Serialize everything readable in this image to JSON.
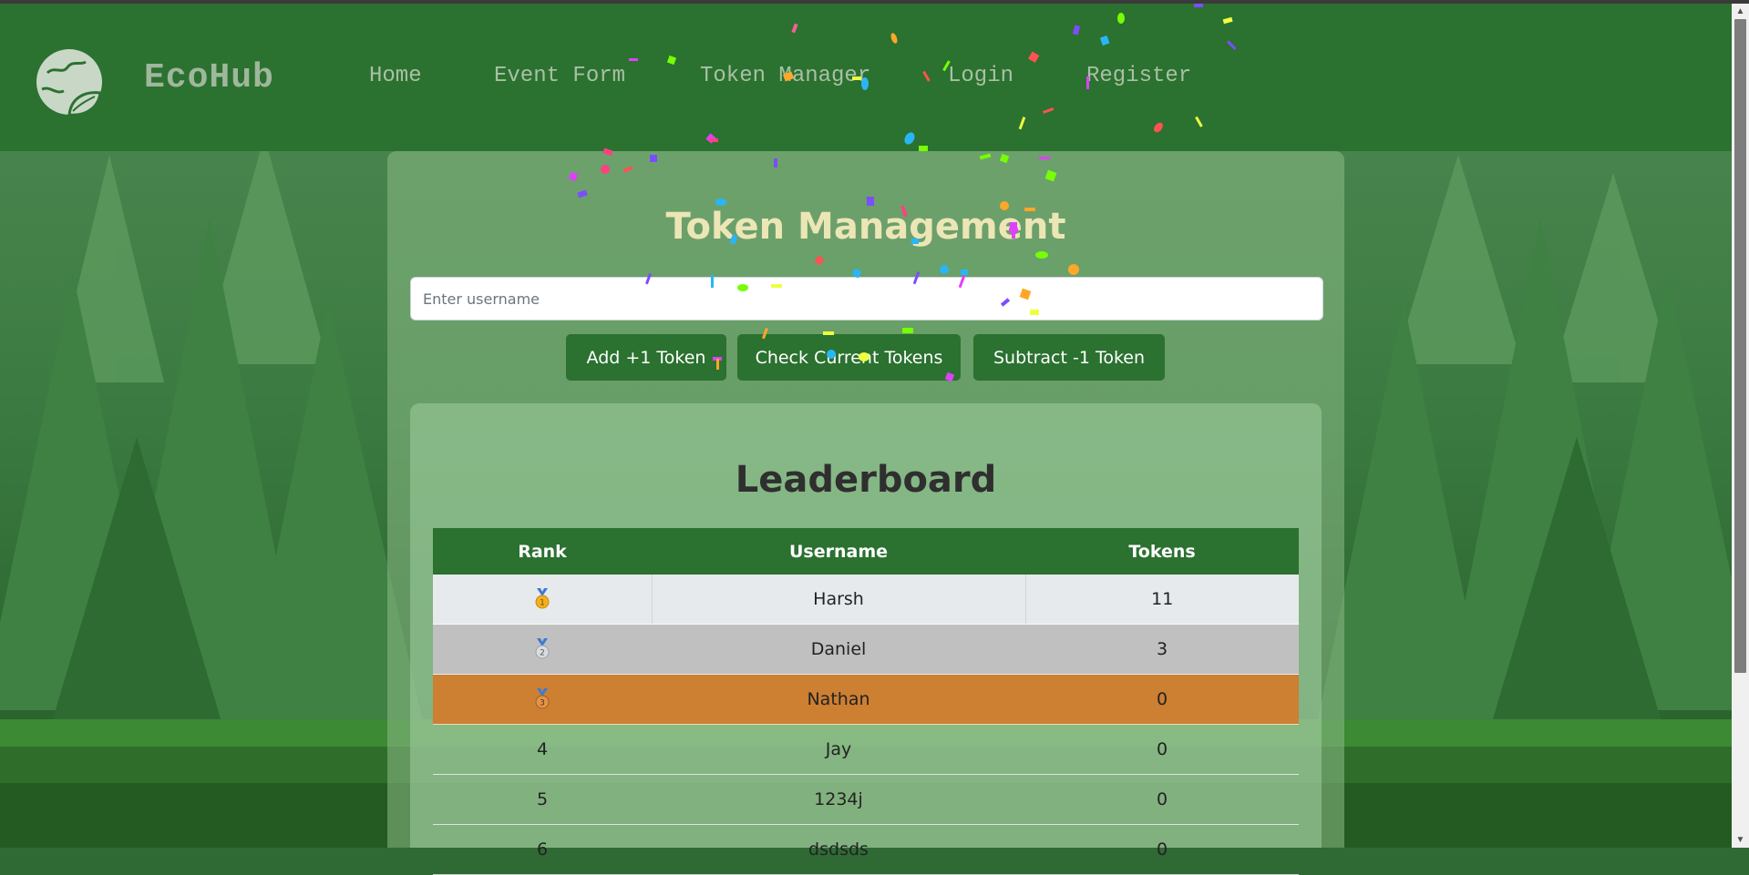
{
  "nav": {
    "brand": "EcoHub",
    "links": [
      "Home",
      "Event Form",
      "Token Manager",
      "Login",
      "Register"
    ]
  },
  "token_manager": {
    "title": "Token Management",
    "username_placeholder": "Enter username",
    "username_value": "",
    "buttons": {
      "add": "Add +1 Token",
      "check": "Check Current Tokens",
      "subtract": "Subtract -1 Token"
    }
  },
  "leaderboard": {
    "title": "Leaderboard",
    "columns": [
      "Rank",
      "Username",
      "Tokens"
    ],
    "rows": [
      {
        "rank": "",
        "medal": "gold-medal-icon",
        "username": "Harsh",
        "tokens": "11"
      },
      {
        "rank": "",
        "medal": "silver-medal-icon",
        "username": "Daniel",
        "tokens": "3"
      },
      {
        "rank": "",
        "medal": "bronze-medal-icon",
        "username": "Nathan",
        "tokens": "0"
      },
      {
        "rank": "4",
        "username": "Jay",
        "tokens": "0"
      },
      {
        "rank": "5",
        "username": "1234j",
        "tokens": "0"
      },
      {
        "rank": "6",
        "username": "dsdsds",
        "tokens": "0"
      }
    ]
  },
  "colors": {
    "nav_bg": "#2b7130",
    "accent_green": "#2b7130",
    "title_cream": "#ece6b6",
    "gold_row": "#e7eaed",
    "silver_row": "#c0c0c0",
    "bronze_row": "#cd7f32"
  }
}
